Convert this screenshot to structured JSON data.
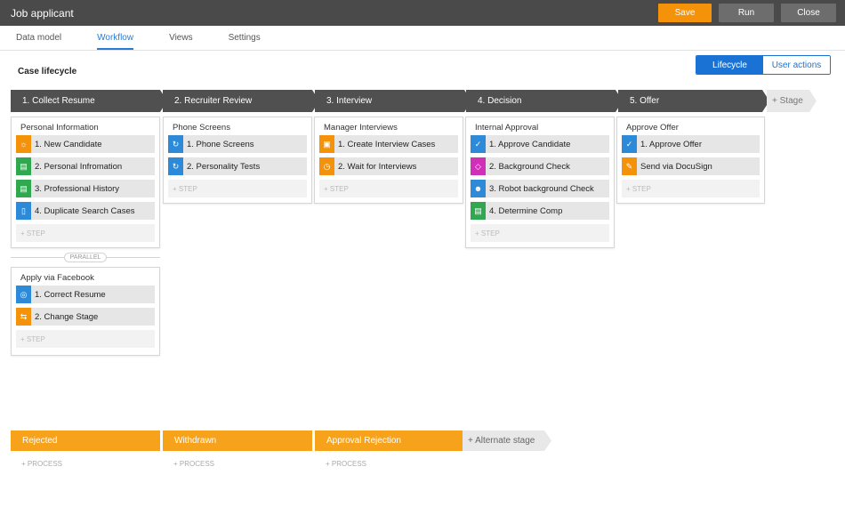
{
  "app": {
    "title": "Job applicant"
  },
  "toolbar": {
    "save": "Save",
    "run": "Run",
    "close": "Close"
  },
  "tabs": [
    "Data model",
    "Workflow",
    "Views",
    "Settings"
  ],
  "case_title": "Case lifecycle",
  "view_toggle": {
    "lifecycle": "Lifecycle",
    "user_actions": "User actions"
  },
  "stages": [
    {
      "label": "1. Collect Resume"
    },
    {
      "label": "2. Recruiter Review"
    },
    {
      "label": "3. Interview"
    },
    {
      "label": "4. Decision"
    },
    {
      "label": "5. Offer"
    }
  ],
  "add_stage": "+ Stage",
  "processes": {
    "personal_information": {
      "name": "Personal Information",
      "steps": [
        "1. New Candidate",
        "2. Personal Infromation",
        "3. Professional History",
        "4. Duplicate Search Cases"
      ]
    },
    "phone_screens": {
      "name": "Phone Screens",
      "steps": [
        "1. Phone Screens",
        "2. Personality Tests"
      ]
    },
    "manager_interviews": {
      "name": "Manager Interviews",
      "steps": [
        "1. Create Interview Cases",
        "2. Wait for Interviews"
      ]
    },
    "internal_approval": {
      "name": "Internal Approval",
      "steps": [
        "1. Approve Candidate",
        "2. Background Check",
        "3. Robot background Check",
        "4. Determine Comp"
      ]
    },
    "approve_offer": {
      "name": "Approve Offer",
      "steps": [
        "1. Approve Offer",
        "Send via DocuSign"
      ]
    },
    "apply_via_facebook": {
      "name": "Apply via Facebook",
      "steps": [
        "1. Correct Resume",
        "2. Change Stage"
      ]
    }
  },
  "add_step": "+ STEP",
  "parallel_label": "PARALLEL",
  "alternate_stages": [
    "Rejected",
    "Withdrawn",
    "Approval Rejection"
  ],
  "add_alternate_stage": "+ Alternate stage",
  "add_process": "+ PROCESS",
  "colors": {
    "orange": "#f4920a",
    "green": "#2fa84f",
    "blue": "#2c8ad8",
    "magenta": "#d22fb8",
    "stage": "#505050"
  }
}
